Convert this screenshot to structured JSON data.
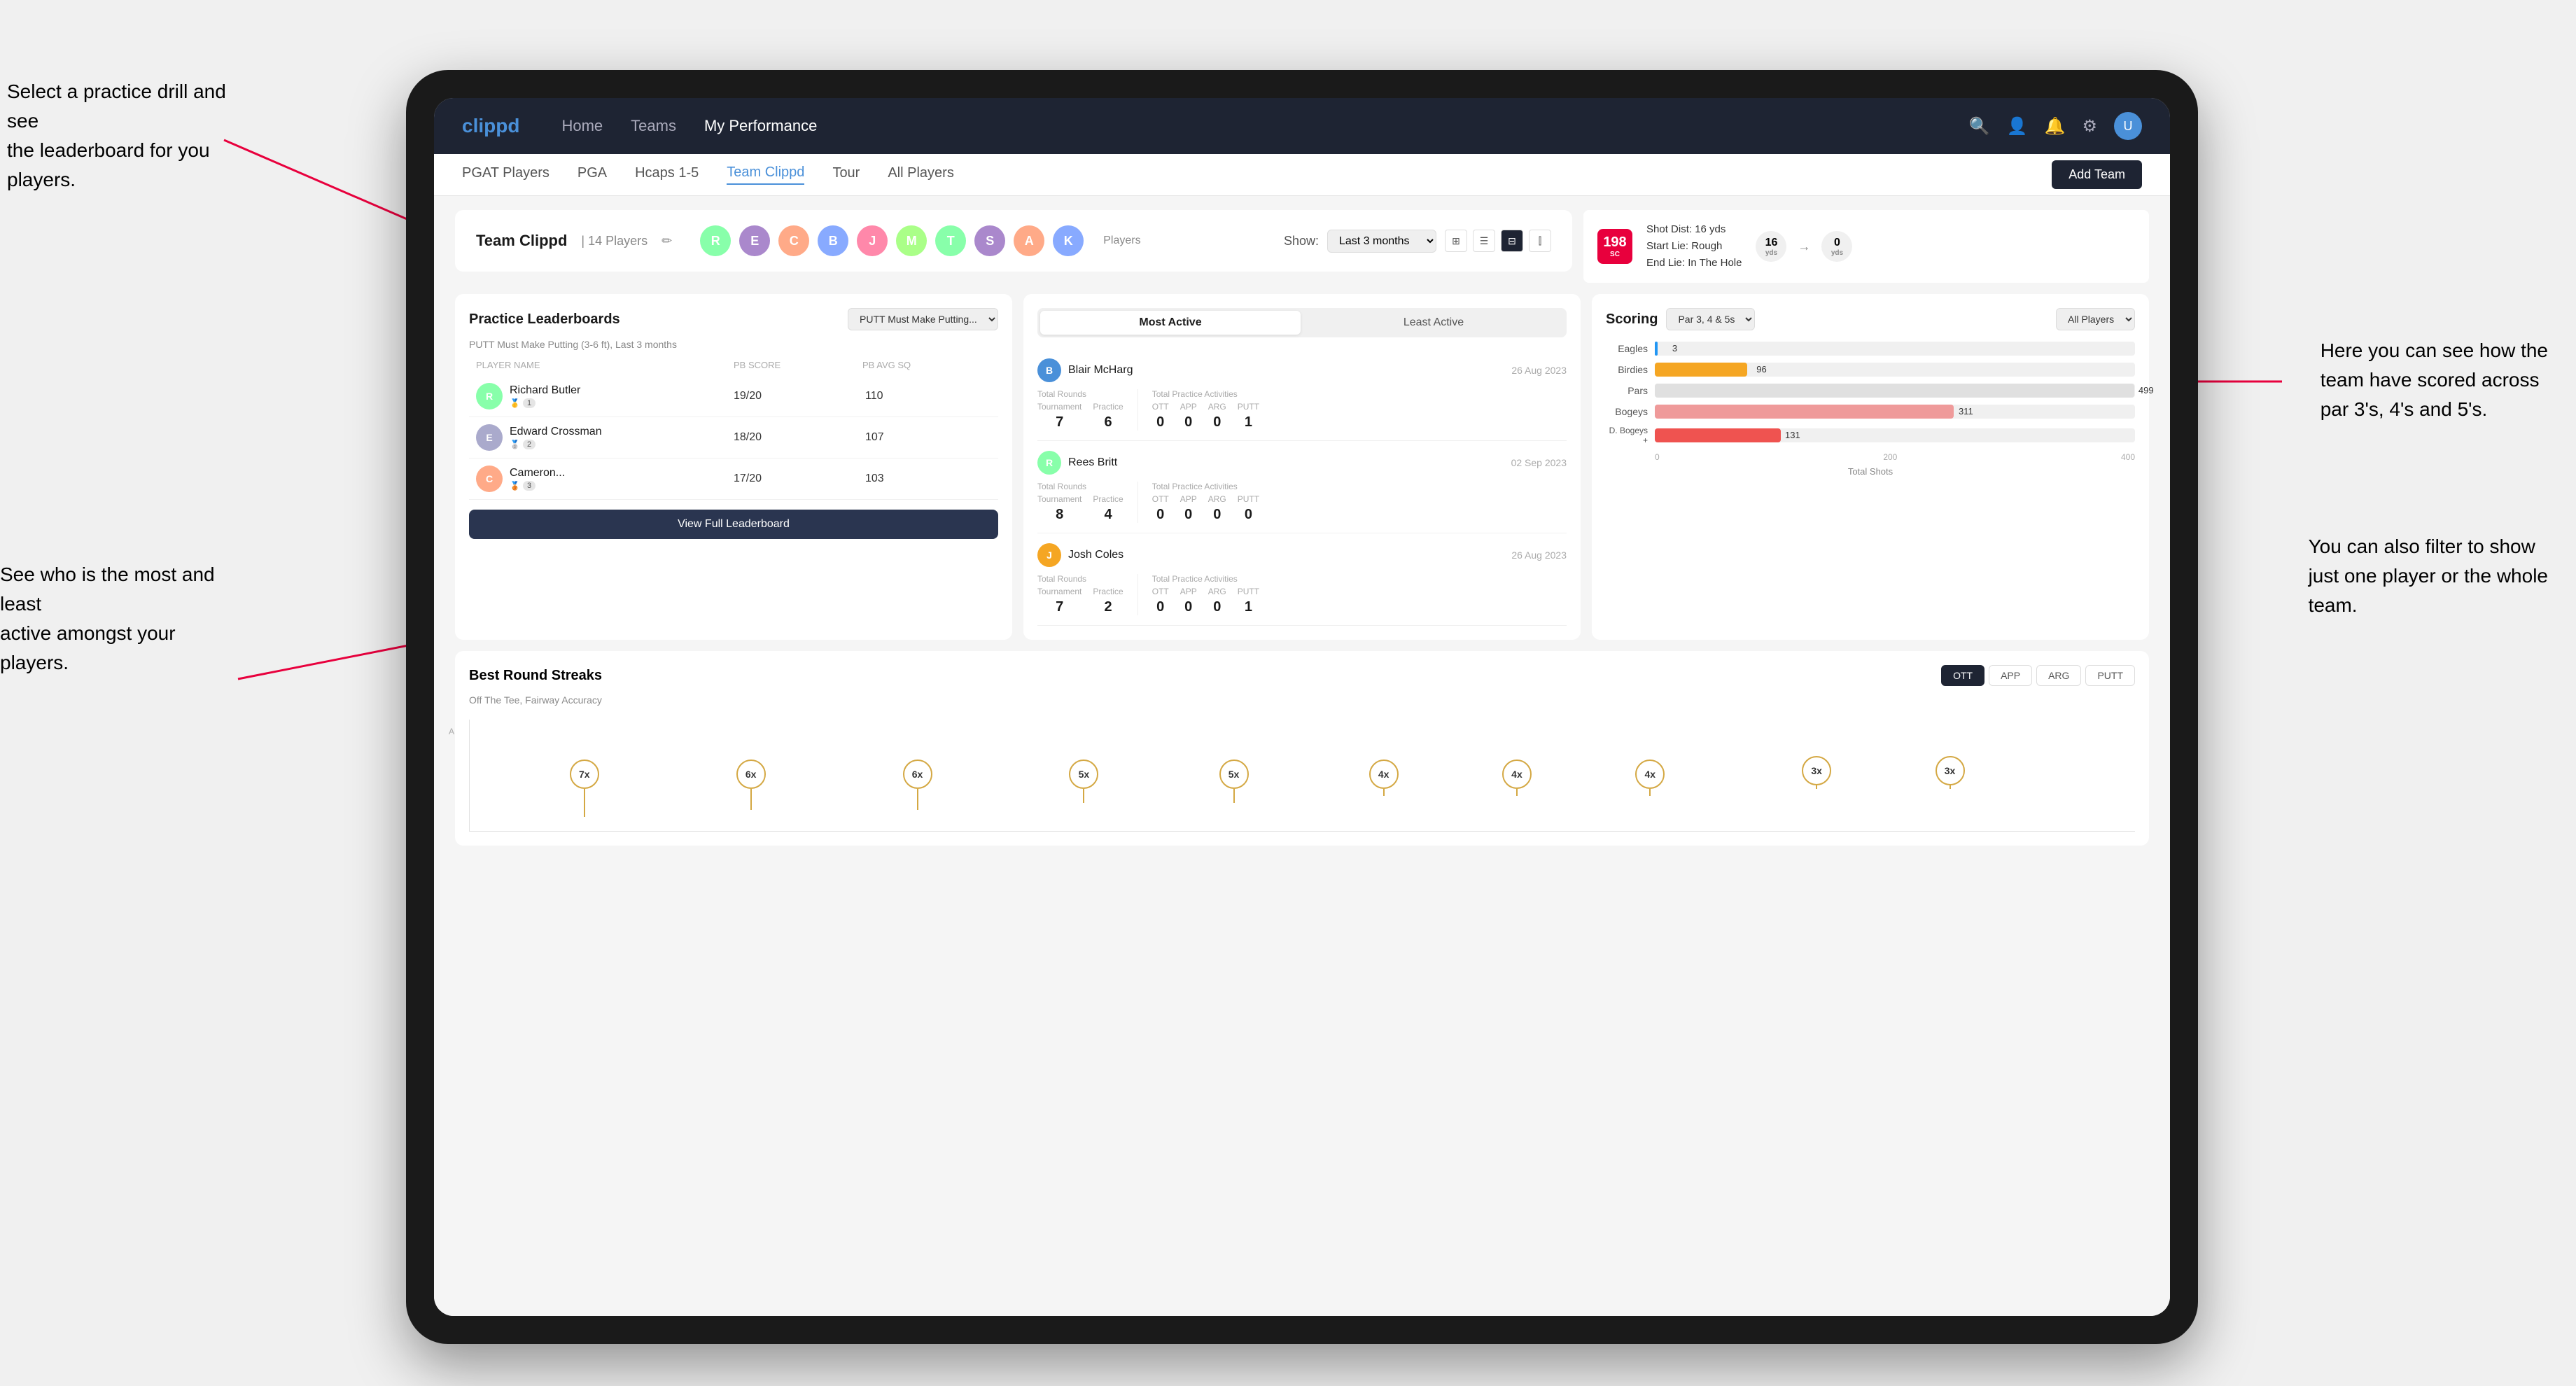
{
  "annotations": {
    "top_left": {
      "title": "Select a practice drill and see\nthe leaderboard for you players."
    },
    "bottom_left": {
      "title": "See who is the most and least\nactive amongst your players."
    },
    "right1": {
      "title": "Here you can see how the\nteam have scored across\npar 3's, 4's and 5's."
    },
    "right2": {
      "title": "You can also filter to show\njust one player or the whole\nteam."
    }
  },
  "navbar": {
    "logo": "clippd",
    "links": [
      "Home",
      "Teams",
      "My Performance"
    ],
    "icons": [
      "search",
      "person",
      "bell",
      "settings",
      "avatar"
    ]
  },
  "subnav": {
    "links": [
      "PGAT Players",
      "PGA",
      "Hcaps 1-5",
      "Team Clippd",
      "Tour",
      "All Players"
    ],
    "active": "Team Clippd",
    "add_button": "Add Team"
  },
  "team_header": {
    "title": "Team Clippd",
    "count": "14 Players",
    "show_label": "Show:",
    "show_value": "Last 3 months",
    "players_label": "Players"
  },
  "shot_info": {
    "badge": "198",
    "badge_sub": "SC",
    "line1": "Shot Dist: 16 yds",
    "line2": "Start Lie: Rough",
    "line3": "End Lie: In The Hole",
    "yds1": "16",
    "yds2": "0",
    "yds_label1": "yds",
    "yds_label2": "yds"
  },
  "practice_leaderboards": {
    "title": "Practice Leaderboards",
    "dropdown": "PUTT Must Make Putting...",
    "subtitle": "PUTT Must Make Putting (3-6 ft), Last 3 months",
    "table_headers": [
      "PLAYER NAME",
      "PB SCORE",
      "PB AVG SQ"
    ],
    "players": [
      {
        "name": "Richard Butler",
        "score": "19/20",
        "avg": "110",
        "badge": "gold",
        "badge_num": "1"
      },
      {
        "name": "Edward Crossman",
        "score": "18/20",
        "avg": "107",
        "badge": "silver",
        "badge_num": "2"
      },
      {
        "name": "Cameron...",
        "score": "17/20",
        "avg": "103",
        "badge": "bronze",
        "badge_num": "3"
      }
    ],
    "view_full": "View Full Leaderboard"
  },
  "activity": {
    "tabs": [
      "Most Active",
      "Least Active"
    ],
    "active_tab": "Most Active",
    "players": [
      {
        "name": "Blair McHarg",
        "date": "26 Aug 2023",
        "total_rounds_label": "Total Rounds",
        "tournament": "7",
        "practice": "6",
        "total_practice_label": "Total Practice Activities",
        "ott": "0",
        "app": "0",
        "arg": "0",
        "putt": "1"
      },
      {
        "name": "Rees Britt",
        "date": "02 Sep 2023",
        "total_rounds_label": "Total Rounds",
        "tournament": "8",
        "practice": "4",
        "total_practice_label": "Total Practice Activities",
        "ott": "0",
        "app": "0",
        "arg": "0",
        "putt": "0"
      },
      {
        "name": "Josh Coles",
        "date": "26 Aug 2023",
        "total_rounds_label": "Total Rounds",
        "tournament": "7",
        "practice": "2",
        "total_practice_label": "Total Practice Activities",
        "ott": "0",
        "app": "0",
        "arg": "0",
        "putt": "1"
      }
    ]
  },
  "scoring": {
    "title": "Scoring",
    "filter": "Par 3, 4 & 5s",
    "player_filter": "All Players",
    "bars": [
      {
        "label": "Eagles",
        "value": 3,
        "max": 500,
        "class": "eagles"
      },
      {
        "label": "Birdies",
        "value": 96,
        "max": 500,
        "class": "birdies"
      },
      {
        "label": "Pars",
        "value": 499,
        "max": 500,
        "class": "pars"
      },
      {
        "label": "Bogeys",
        "value": 311,
        "max": 500,
        "class": "bogeys"
      },
      {
        "label": "D. Bogeys +",
        "value": 131,
        "max": 500,
        "class": "dbogeys"
      }
    ],
    "x_labels": [
      "0",
      "200",
      "400"
    ],
    "x_title": "Total Shots"
  },
  "streaks": {
    "title": "Best Round Streaks",
    "subtitle": "Off The Tee, Fairway Accuracy",
    "tabs": [
      "OTT",
      "APP",
      "ARG",
      "PUTT"
    ],
    "active_tab": "OTT",
    "dots": [
      {
        "label": "7x",
        "pos": 8
      },
      {
        "label": "6x",
        "pos": 18
      },
      {
        "label": "6x",
        "pos": 28
      },
      {
        "label": "5x",
        "pos": 38
      },
      {
        "label": "5x",
        "pos": 48
      },
      {
        "label": "4x",
        "pos": 58
      },
      {
        "label": "4x",
        "pos": 68
      },
      {
        "label": "4x",
        "pos": 78
      },
      {
        "label": "3x",
        "pos": 88
      },
      {
        "label": "3x",
        "pos": 95
      }
    ]
  }
}
